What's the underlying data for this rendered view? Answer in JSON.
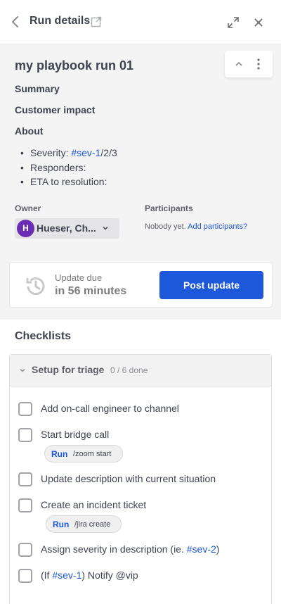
{
  "header": {
    "title": "Run details",
    "icons": [
      "chevron-left-icon",
      "external-link-icon",
      "expand-icon",
      "close-icon"
    ]
  },
  "run": {
    "title": "my playbook run 01",
    "sections": [
      "Summary",
      "Customer impact",
      "About"
    ],
    "about_bullets": {
      "severity_label": "Severity: ",
      "severity_link": "#sev-1",
      "severity_rest": "/2/3",
      "responders": "Responders:",
      "eta": "ETA to resolution:"
    },
    "owner_label": "Owner",
    "owner_initial": "H",
    "owner_name": "Hueser, Ch...",
    "participants_label": "Participants",
    "participants_empty": "Nobody yet.",
    "add_participants": "Add participants?"
  },
  "update": {
    "due_label": "Update due",
    "due_value": "in 56 minutes",
    "post_button": "Post update"
  },
  "checklists": {
    "heading": "Checklists",
    "group_name": "Setup for triage",
    "group_count": "0 / 6 done",
    "items": [
      {
        "text": "Add on-call engineer to channel"
      },
      {
        "text": "Start bridge call",
        "run": "Run",
        "command": "/zoom start"
      },
      {
        "text": "Update description with current situation"
      },
      {
        "text": "Create an incident ticket",
        "run": "Run",
        "command": "/jira create"
      },
      {
        "text_pre": "Assign severity in description (ie. ",
        "link": "#sev-2",
        "text_post": ")"
      },
      {
        "text_pre": "(If ",
        "link": "#sev-1",
        "text_post": ") Notify @vip"
      }
    ]
  },
  "colors": {
    "accent": "#1c58d9",
    "avatar": "#6a2eb3"
  }
}
